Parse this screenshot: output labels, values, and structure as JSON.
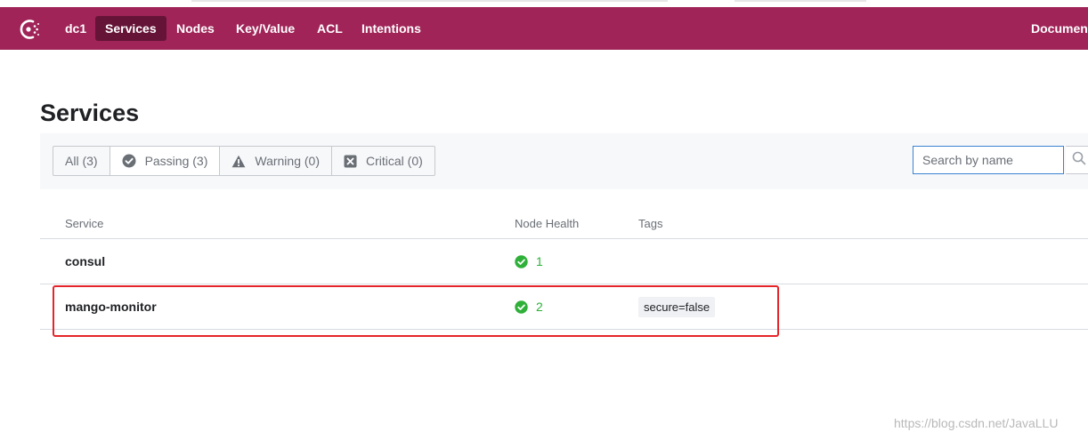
{
  "nav": {
    "datacenter": "dc1",
    "items": [
      {
        "label": "Services",
        "active": true
      },
      {
        "label": "Nodes",
        "active": false
      },
      {
        "label": "Key/Value",
        "active": false
      },
      {
        "label": "ACL",
        "active": false
      },
      {
        "label": "Intentions",
        "active": false
      }
    ],
    "right_link": "Documen"
  },
  "page": {
    "title": "Services"
  },
  "filters": [
    {
      "label": "All (3)",
      "icon": "",
      "selected": false
    },
    {
      "label": "Passing (3)",
      "icon": "check-circle-icon",
      "selected": true
    },
    {
      "label": "Warning (0)",
      "icon": "warning-icon",
      "selected": false
    },
    {
      "label": "Critical (0)",
      "icon": "x-square-icon",
      "selected": false
    }
  ],
  "search": {
    "placeholder": "Search by name",
    "value": ""
  },
  "table": {
    "headers": {
      "service": "Service",
      "node_health": "Node Health",
      "tags": "Tags"
    },
    "rows": [
      {
        "service": "consul",
        "health": "1",
        "tags": []
      },
      {
        "service": "mango-monitor",
        "health": "2",
        "tags": [
          "secure=false"
        ]
      }
    ]
  },
  "colors": {
    "brand": "#a02458",
    "brand_dark": "#651437",
    "passing": "#2eb039",
    "highlight": "#e5252a"
  },
  "watermark": "https://blog.csdn.net/JavaLLU"
}
